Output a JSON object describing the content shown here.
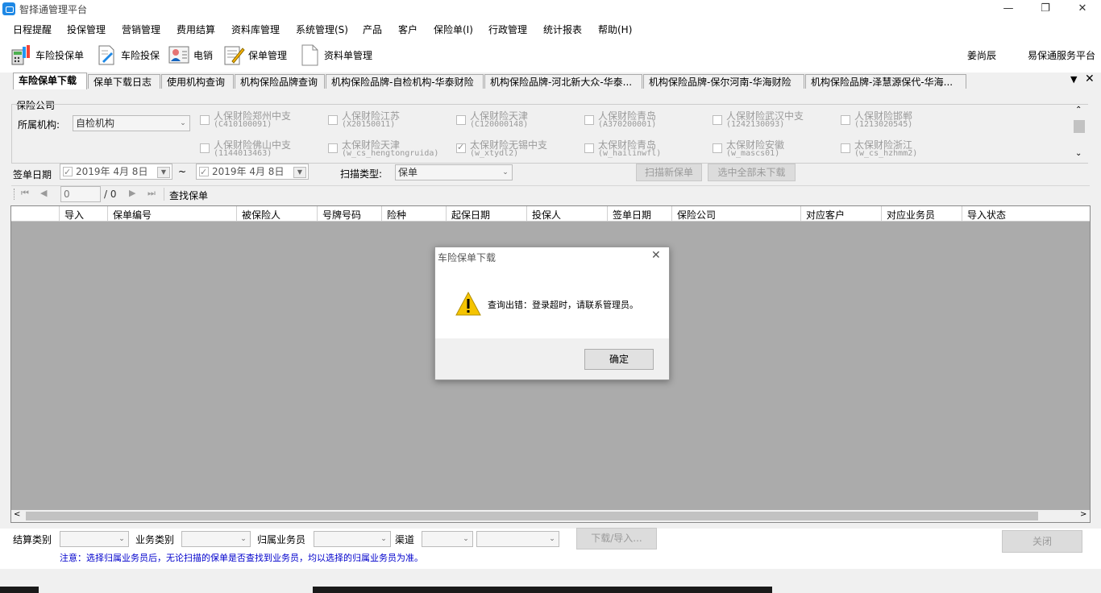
{
  "window": {
    "title": "智择通管理平台",
    "min_icon": "minimize-icon",
    "max_icon": "restore-icon",
    "close_icon": "close-icon"
  },
  "menu": [
    "日程提醒",
    "投保管理",
    "营销管理",
    "费用结算",
    "资料库管理",
    "系统管理(S)",
    "产品",
    "客户",
    "保险单(I)",
    "行政管理",
    "统计报表",
    "帮助(H)"
  ],
  "toolbar": {
    "buttons": [
      {
        "label": "车险投保单",
        "icon": "calculator-icon"
      },
      {
        "label": "车险投保",
        "icon": "document-edit-icon"
      },
      {
        "label": "电销",
        "icon": "contact-card-icon"
      },
      {
        "label": "保单管理",
        "icon": "notepad-pen-icon"
      },
      {
        "label": "资料单管理",
        "icon": "document-icon"
      }
    ],
    "user": "姜尚辰",
    "service_link": "易保通服务平台"
  },
  "tabs": [
    "车险保单下载",
    "保单下载日志",
    "使用机构查询",
    "机构保险品牌查询",
    "机构保险品牌-自检机构-华泰财险",
    "机构保险品牌-河北新大众-华泰...",
    "机构保险品牌-保尔河南-华海财险",
    "机构保险品牌-泽慧源保代-华海..."
  ],
  "filters": {
    "group_label": "保险公司",
    "org_label": "所属机构:",
    "org_value": "自检机构",
    "companies": [
      {
        "name": "人保财险郑州中支",
        "code": "(C410100091)",
        "checked": false
      },
      {
        "name": "人保财险江苏",
        "code": "(X20150011)",
        "checked": false
      },
      {
        "name": "人保财险天津",
        "code": "(C120000148)",
        "checked": false
      },
      {
        "name": "人保财险青岛",
        "code": "(A370200001)",
        "checked": false
      },
      {
        "name": "人保财险武汉中支",
        "code": "(1242130093)",
        "checked": false
      },
      {
        "name": "人保财险邯郸",
        "code": "(1213020545)",
        "checked": false
      },
      {
        "name": "人保财险佛山中支",
        "code": "(1144013463)",
        "checked": false
      },
      {
        "name": "太保财险天津",
        "code": "(w_cs_hengtongruida)",
        "checked": false
      },
      {
        "name": "太保财险无锡中支",
        "code": "(w_xtydl2)",
        "checked": true
      },
      {
        "name": "太保财险青岛",
        "code": "(w_hailinwfl)",
        "checked": false
      },
      {
        "name": "太保财险安徽",
        "code": "(w_mascs01)",
        "checked": false
      },
      {
        "name": "太保财险浙江",
        "code": "(w_cs_hzhmm2)",
        "checked": false
      }
    ],
    "sign_date_label": "签单日期",
    "date_from": "2019年  4月  8日",
    "date_tilde": "~",
    "date_to": "2019年  4月  8日",
    "scan_type_label": "扫描类型:",
    "scan_type_value": "保单",
    "scan_new_button": "扫描新保单",
    "select_all_button": "选中全部未下载"
  },
  "pager": {
    "page_value": "0",
    "total": "/ 0",
    "find_label": "查找保单"
  },
  "grid": {
    "columns": [
      "导入",
      "保单编号",
      "被保险人",
      "号牌号码",
      "险种",
      "起保日期",
      "投保人",
      "签单日期",
      "保险公司",
      "对应客户",
      "对应业务员",
      "导入状态"
    ]
  },
  "bottom": {
    "settle_label": "结算类别",
    "business_label": "业务类别",
    "salesman_label": "归属业务员",
    "channel_label": "渠道",
    "download_button": "下载/导入...",
    "close_button": "关闭",
    "note": "注意：选择归属业务员后，无论扫描的保单是否查找到业务员，均以选择的归属业务员为准。"
  },
  "dialog": {
    "title": "车险保单下载",
    "message": "查询出错：登录超时，请联系管理员。",
    "ok_button": "确定",
    "icon": "warning-icon"
  },
  "colors": {
    "accent_blue": "#1e88e5",
    "grid_bg": "#ababab",
    "note_blue": "#0000cc",
    "warning_yellow": "#f5c400"
  }
}
